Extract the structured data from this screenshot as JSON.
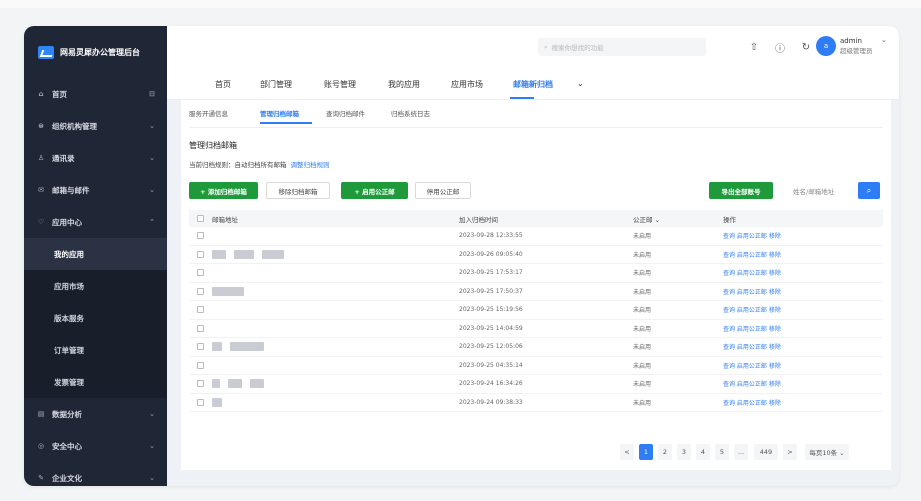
{
  "brand": {
    "name": "网易灵犀办公管理后台"
  },
  "sidebar": {
    "items": [
      {
        "icon": "⌂",
        "label": "首页",
        "arrow": "⊟"
      },
      {
        "icon": "⊜",
        "label": "组织机构管理",
        "arrow": "⌄"
      },
      {
        "icon": "♙",
        "label": "通讯录",
        "arrow": "⌄"
      },
      {
        "icon": "✉",
        "label": "邮箱与邮件",
        "arrow": "⌄"
      },
      {
        "icon": "♡",
        "label": "应用中心",
        "arrow": "⌃"
      }
    ],
    "subitems": [
      "我的应用",
      "应用市场",
      "版本服务",
      "订单管理",
      "发票管理"
    ],
    "bottom_items": [
      {
        "icon": "▤",
        "label": "数据分析",
        "arrow": "⌄"
      },
      {
        "icon": "◎",
        "label": "安全中心",
        "arrow": "⌄"
      },
      {
        "icon": "✎",
        "label": "企业文化",
        "arrow": "⌄"
      }
    ]
  },
  "header": {
    "search_placeholder": "搜索你想找的功能",
    "icons": [
      "upload-icon",
      "help-icon",
      "refresh-icon"
    ],
    "avatar_letter": "a",
    "user_name": "admin",
    "user_role": "超级管理员"
  },
  "tabs": [
    "首页",
    "部门管理",
    "账号管理",
    "我的应用",
    "应用市场",
    "邮箱新归档",
    "⌄"
  ],
  "subtabs": [
    "服务开通信息",
    "管理归档邮箱",
    "查询归档邮件",
    "归档系统日志"
  ],
  "panel": {
    "title": "管理归档邮箱",
    "rule_text": "当前归档规则：自动归档所有邮箱",
    "rule_link": "调整归档规则"
  },
  "actions": {
    "add": "+ 添加归档邮箱",
    "remove": "移除归档邮箱",
    "enable_notary": "+ 启用公正邮",
    "disable_notary": "停用公正邮",
    "export": "导出全部账号",
    "search_placeholder": "姓名/邮箱地址"
  },
  "table": {
    "headers": [
      "邮箱地址",
      "加入归档时间",
      "公正邮 ⌄",
      "操作"
    ],
    "ops": "查询 启用公正邮 移除",
    "rows": [
      {
        "time": "2023-09-28 12:33:55",
        "status": "未启用"
      },
      {
        "time": "2023-09-26 09:05:40",
        "status": "未启用"
      },
      {
        "time": "2023-09-25 17:53:17",
        "status": "未启用"
      },
      {
        "time": "2023-09-25 17:50:37",
        "status": "未启用"
      },
      {
        "time": "2023-09-25 15:19:56",
        "status": "未启用"
      },
      {
        "time": "2023-09-25 14:04:59",
        "status": "未启用"
      },
      {
        "time": "2023-09-25 12:05:06",
        "status": "未启用"
      },
      {
        "time": "2023-09-25 04:35:14",
        "status": "未启用"
      },
      {
        "time": "2023-09-24 16:34:26",
        "status": "未启用"
      },
      {
        "time": "2023-09-24 09:38:33",
        "status": "未启用"
      }
    ]
  },
  "pagination": {
    "prev": "<",
    "pages": [
      "1",
      "2",
      "3",
      "4",
      "5"
    ],
    "ellipsis": "...",
    "last": "449",
    "next": ">",
    "current": "1",
    "page_size": "每页10条 ⌄"
  },
  "colors": {
    "accent": "#2e7cf6",
    "green": "#1f9a3b",
    "sidebar": "#1f2635"
  }
}
